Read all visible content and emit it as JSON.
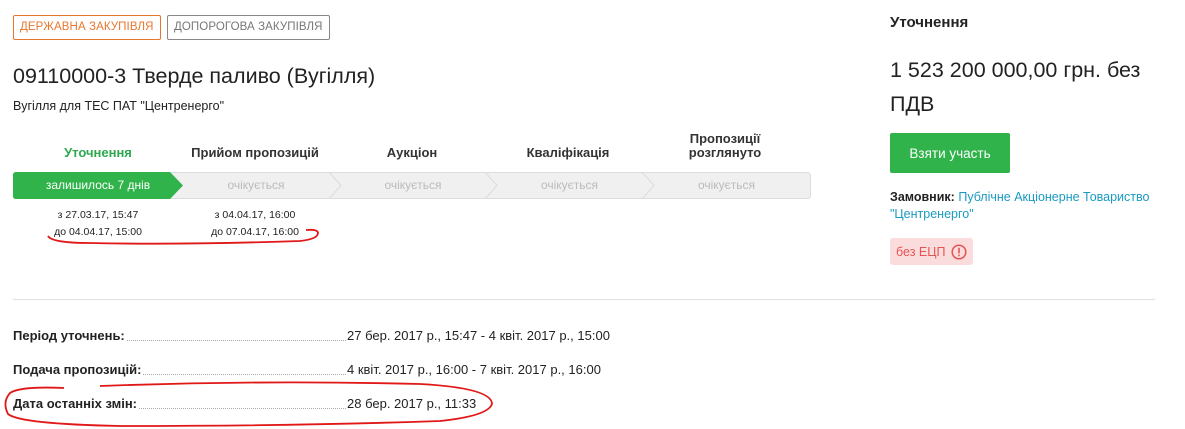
{
  "tags": {
    "state": "ДЕРЖАВНА ЗАКУПІВЛЯ",
    "prethreshold": "ДОПОРОГОВА ЗАКУПІВЛЯ"
  },
  "tender": {
    "title": "09110000-3 Тверде паливо (Вугілля)",
    "subtitle": "Вугілля для ТЕС ПАТ \"Центренерго\""
  },
  "stages": [
    {
      "label": "Уточнення",
      "status": "залишилось 7 днів",
      "active": true,
      "date_from": "з 27.03.17, 15:47",
      "date_to": "до 04.04.17, 15:00"
    },
    {
      "label": "Прийом пропозицій",
      "status": "очікується",
      "active": false,
      "date_from": "з 04.04.17, 16:00",
      "date_to": "до 07.04.17, 16:00"
    },
    {
      "label": "Аукціон",
      "status": "очікується",
      "active": false
    },
    {
      "label": "Кваліфікація",
      "status": "очікується",
      "active": false
    },
    {
      "label": "Пропозиції розглянуто",
      "status": "очікується",
      "active": false
    }
  ],
  "info": {
    "clarification_period_label": "Період уточнень:",
    "clarification_period_value": "27 бер. 2017 р., 15:47 - 4 квіт. 2017 р., 15:00",
    "submission_label": "Подача пропозицій:",
    "submission_value": "4 квіт. 2017 р., 16:00 - 7 квіт. 2017 р., 16:00",
    "last_change_label": "Дата останніх змін:",
    "last_change_value": "28 бер. 2017 р., 11:33"
  },
  "sidebar": {
    "status": "Уточнення",
    "amount": "1 523 200 000,00 грн. без ПДВ",
    "participate_button": "Взяти участь",
    "customer_label": "Замовник:",
    "customer_name": "Публічне Акціонерне Товариство \"Центренерго\"",
    "no_signature_badge": "без ЕЦП"
  },
  "colors": {
    "accent_green": "#2fb34a",
    "tag_orange": "#e8772e",
    "link_blue": "#1a9bc2",
    "badge_red": "#e35555",
    "annotation_red": "#e01818"
  },
  "icons": {
    "warning": "exclamation-circle-icon"
  }
}
